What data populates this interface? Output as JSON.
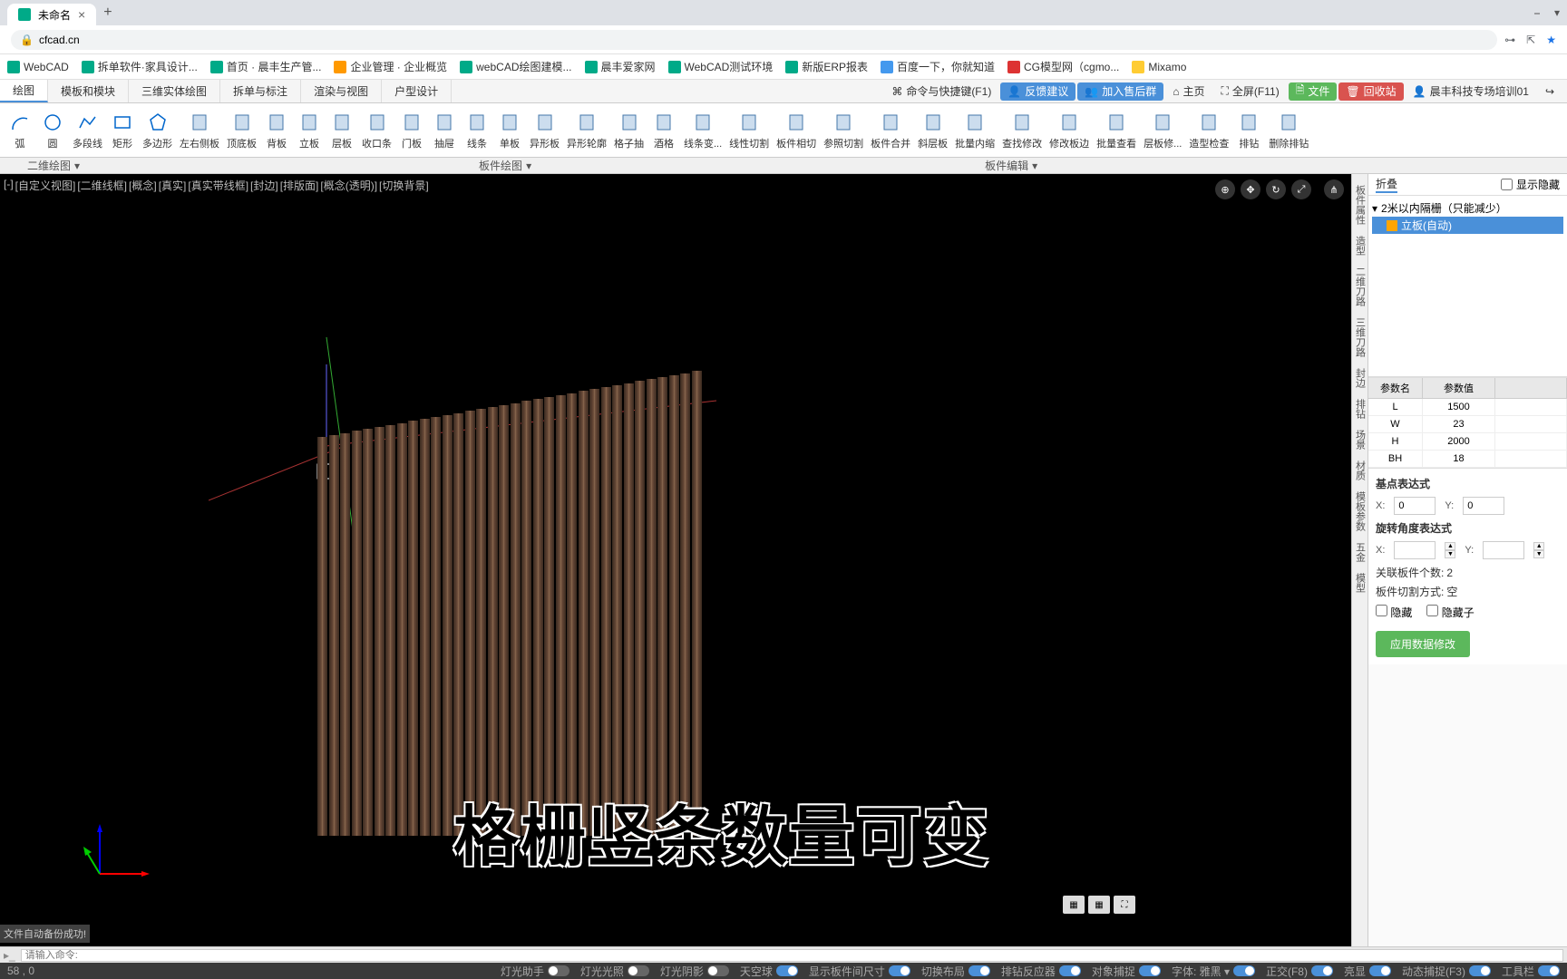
{
  "browser": {
    "tab_title": "未命名",
    "url": "cfcad.cn"
  },
  "bookmarks": [
    {
      "label": "WebCAD",
      "color": "bm-green"
    },
    {
      "label": "拆单软件·家具设计...",
      "color": "bm-green"
    },
    {
      "label": "首页 · 晨丰生产管...",
      "color": "bm-green"
    },
    {
      "label": "企业管理 · 企业概览",
      "color": "bm-orange"
    },
    {
      "label": "webCAD绘图建模...",
      "color": "bm-green"
    },
    {
      "label": "晨丰爱家网",
      "color": "bm-green"
    },
    {
      "label": "WebCAD测试环境",
      "color": "bm-green"
    },
    {
      "label": "新版ERP报表",
      "color": "bm-green"
    },
    {
      "label": "百度一下，你就知道",
      "color": "bm-blue"
    },
    {
      "label": "CG模型网（cgmo...",
      "color": "bm-red"
    },
    {
      "label": "Mixamo",
      "color": "bm-yellow"
    }
  ],
  "menu_tabs": [
    "绘图",
    "模板和模块",
    "三维实体绘图",
    "拆单与标注",
    "渲染与视图",
    "户型设计"
  ],
  "top_right": {
    "shortcut": "命令与快捷键(F1)",
    "feedback": "反馈建议",
    "group": "加入售后群",
    "home": "主页",
    "fullscreen": "全屏(F11)",
    "file": "文件",
    "recycle": "回收站",
    "user": "晨丰科技专场培训01"
  },
  "ribbon": [
    {
      "label": "弧",
      "icon": "arc"
    },
    {
      "label": "圆",
      "icon": "circle"
    },
    {
      "label": "多段线",
      "icon": "polyline"
    },
    {
      "label": "矩形",
      "icon": "rect"
    },
    {
      "label": "多边形",
      "icon": "polygon"
    },
    {
      "label": "左右侧板",
      "icon": "panel-lr"
    },
    {
      "label": "顶底板",
      "icon": "panel-tb"
    },
    {
      "label": "背板",
      "icon": "panel-back"
    },
    {
      "label": "立板",
      "icon": "panel-v"
    },
    {
      "label": "层板",
      "icon": "panel-h"
    },
    {
      "label": "收口条",
      "icon": "strip"
    },
    {
      "label": "门板",
      "icon": "door"
    },
    {
      "label": "抽屉",
      "icon": "drawer"
    },
    {
      "label": "线条",
      "icon": "line"
    },
    {
      "label": "单板",
      "icon": "single"
    },
    {
      "label": "异形板",
      "icon": "special"
    },
    {
      "label": "异形轮廓",
      "icon": "outline"
    },
    {
      "label": "格子抽",
      "icon": "grid"
    },
    {
      "label": "酒格",
      "icon": "wine"
    },
    {
      "label": "线条变...",
      "icon": "lineedit"
    },
    {
      "label": "线性切割",
      "icon": "lcut"
    },
    {
      "label": "板件相切",
      "icon": "tangent"
    },
    {
      "label": "参照切割",
      "icon": "refcut"
    },
    {
      "label": "板件合并",
      "icon": "merge"
    },
    {
      "label": "斜层板",
      "icon": "oblique"
    },
    {
      "label": "批量内缩",
      "icon": "shrink"
    },
    {
      "label": "查找修改",
      "icon": "find"
    },
    {
      "label": "修改板边",
      "icon": "edge"
    },
    {
      "label": "批量查看",
      "icon": "batch"
    },
    {
      "label": "层板修...",
      "icon": "layer"
    },
    {
      "label": "造型检查",
      "icon": "check"
    },
    {
      "label": "排钻",
      "icon": "drill"
    },
    {
      "label": "删除排钻",
      "icon": "deldrill"
    }
  ],
  "sub_ribbon": {
    "left": "二维绘图",
    "mid": "板件绘图",
    "right": "板件编辑"
  },
  "view_modes": [
    "[-]",
    "[自定义视图]",
    "[二维线框]",
    "[概念]",
    "[真实]",
    "[真实带线框]",
    "[封边]",
    "[排版面]",
    "[概念(透明)]",
    "[切换背景]"
  ],
  "save_message": "文件自动备份成功!",
  "side_tabs": [
    "板件属性",
    "造型",
    "二维刀路",
    "三维刀路",
    "封边",
    "排钻",
    "场景",
    "材质",
    "模板参数",
    "五金",
    "模型"
  ],
  "prop_header": {
    "tab1": "折叠",
    "check_label": "显示隐藏"
  },
  "tree": {
    "root": "2米以内隔栅（只能减少）",
    "child": "立板(自动)"
  },
  "param_table": {
    "h1": "参数名",
    "h2": "参数值",
    "rows": [
      {
        "name": "L",
        "val": "1500"
      },
      {
        "name": "W",
        "val": "23"
      },
      {
        "name": "H",
        "val": "2000"
      },
      {
        "name": "BH",
        "val": "18"
      }
    ]
  },
  "expr": {
    "title1": "基点表达式",
    "title2": "旋转角度表达式",
    "x_label": "X:",
    "y_label": "Y:",
    "x_val": "0",
    "y_val": "0",
    "assoc": "关联板件个数:",
    "assoc_val": "2",
    "cut": "板件切割方式:",
    "cut_val": "空",
    "hide": "隐藏",
    "hide_child": "隐藏子",
    "apply": "应用数据修改"
  },
  "overlay": "格栅竖条数量可变",
  "cmd": {
    "placeholder": "请输入命令:",
    "coords": "58 , 0"
  },
  "status": [
    {
      "label": "灯光助手",
      "on": false
    },
    {
      "label": "灯光光照",
      "on": false
    },
    {
      "label": "灯光阴影",
      "on": false
    },
    {
      "label": "天空球",
      "on": true
    },
    {
      "label": "显示板件间尺寸",
      "on": true
    },
    {
      "label": "切换布局",
      "on": true
    },
    {
      "label": "排钻反应器",
      "on": true
    },
    {
      "label": "对象捕捉",
      "on": true
    },
    {
      "label_prefix": "字体:",
      "label": "雅黑",
      "on": true,
      "dropdown": true
    },
    {
      "label": "正交(F8)",
      "on": true
    },
    {
      "label": "亮显",
      "on": true
    },
    {
      "label": "动态捕捉(F3)",
      "on": true
    },
    {
      "label": "工具栏",
      "on": true
    }
  ]
}
